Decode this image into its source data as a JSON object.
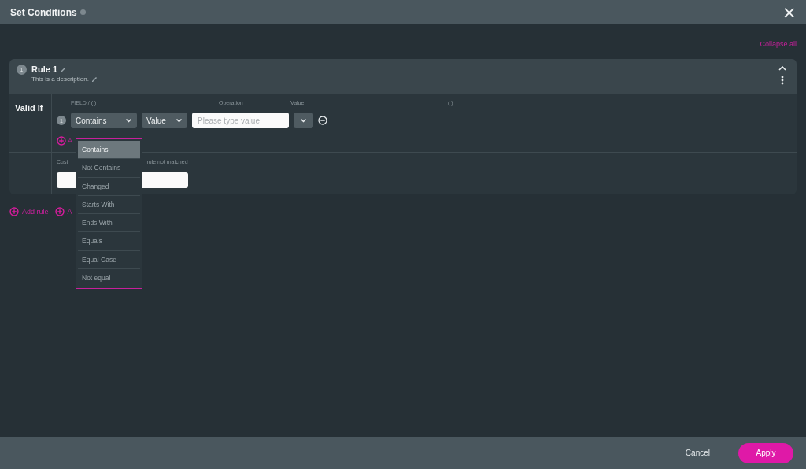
{
  "window": {
    "title": "Set Conditions",
    "close": "×"
  },
  "collapse_all": "Collapse all",
  "rule": {
    "number": "1",
    "title": "Rule 1",
    "description": "This is a description.",
    "expanded": true,
    "section_label": "Valid If",
    "columns": [
      "FIELD / ( )",
      "Operation",
      "Value",
      "( )"
    ],
    "conditions": [
      {
        "number": "1",
        "field": "Contains",
        "operation": "Value",
        "value_placeholder": "Please type value"
      }
    ],
    "add_condition": "A",
    "message_label_left": "Cust",
    "message_label_right": "rule not matched"
  },
  "dropdown": {
    "options": [
      {
        "label": "Contains",
        "selected": true
      },
      {
        "label": "Not Contains",
        "selected": false
      },
      {
        "label": "Changed",
        "selected": false
      },
      {
        "label": "Starts With",
        "selected": false
      },
      {
        "label": "Ends With",
        "selected": false
      },
      {
        "label": "Equals",
        "selected": false
      },
      {
        "label": "Equal Case",
        "selected": false
      },
      {
        "label": "Not equal",
        "selected": false
      }
    ]
  },
  "add_links": [
    {
      "label": "Add rule"
    },
    {
      "label": "A"
    }
  ],
  "footer": {
    "cancel": "Cancel",
    "apply": "Apply"
  }
}
